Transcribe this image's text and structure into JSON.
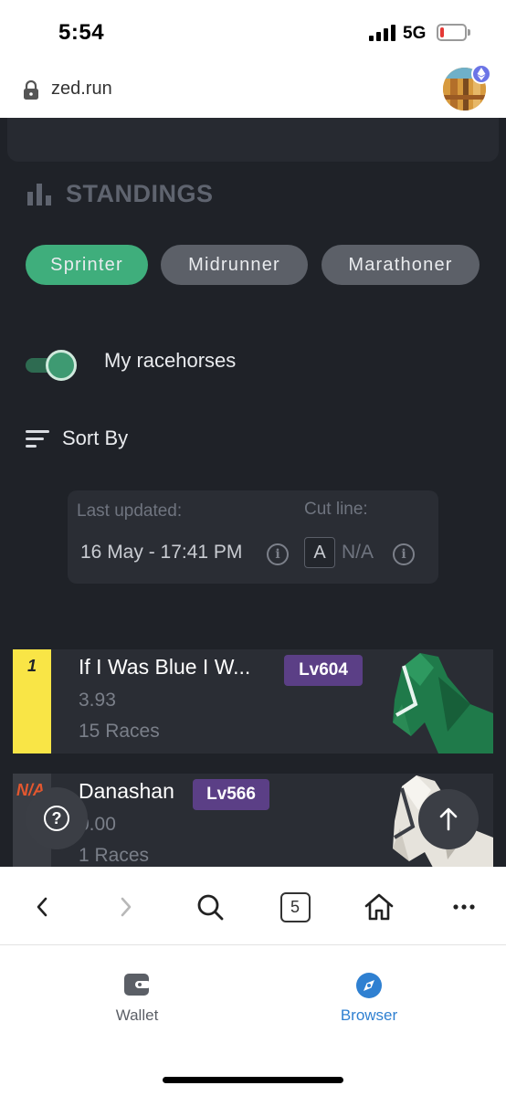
{
  "status_bar": {
    "time": "5:54",
    "network": "5G"
  },
  "url_bar": {
    "url": "zed.run"
  },
  "standings": {
    "title": "STANDINGS",
    "filters": [
      "Sprinter",
      "Midrunner",
      "Marathoner"
    ],
    "active_filter": "Sprinter",
    "toggle_label": "My racehorses",
    "toggle_on": true,
    "sort_label": "Sort By"
  },
  "info": {
    "last_updated_label": "Last updated:",
    "last_updated_value": "16 May - 17:41 PM",
    "cut_line_label": "Cut line:",
    "cut_line_grade": "A",
    "cut_line_value": "N/A"
  },
  "horses": [
    {
      "rank": "1",
      "name": "If I Was Blue I W...",
      "level": "Lv604",
      "score": "3.93",
      "races": "15 Races",
      "rank_color": "#f9e546"
    },
    {
      "rank": "N/A",
      "name": "Danashan",
      "level": "Lv566",
      "score": "0.00",
      "races": "1 Races",
      "rank_color": "#3a3d44"
    }
  ],
  "toolbar": {
    "tab_count": "5"
  },
  "app_tabs": [
    {
      "label": "Wallet",
      "active": false
    },
    {
      "label": "Browser",
      "active": true
    }
  ],
  "colors": {
    "accent_green": "#3fae7c",
    "level_purple": "#5b3f86",
    "browser_blue": "#2f80d1"
  }
}
